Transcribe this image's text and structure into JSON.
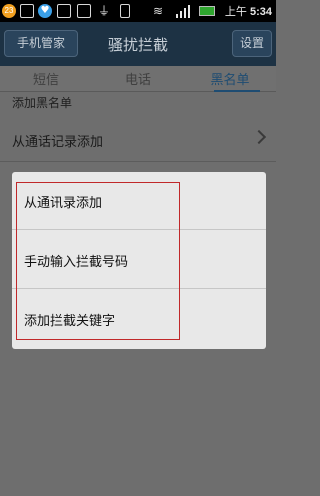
{
  "statusbar": {
    "badge": "23",
    "time_prefix": "上午",
    "time": "5:34"
  },
  "titlebar": {
    "back_label": "手机管家",
    "title": "骚扰拦截",
    "settings_label": "设置"
  },
  "tabs": [
    {
      "label": "短信"
    },
    {
      "label": "电话"
    },
    {
      "label": "黑名单",
      "active": true
    }
  ],
  "content": {
    "section_header": "添加黑名单",
    "row_label": "从通话记录添加"
  },
  "dialog": {
    "items": [
      {
        "label": "从通讯录添加"
      },
      {
        "label": "手动输入拦截号码"
      },
      {
        "label": "添加拦截关键字"
      }
    ]
  },
  "icons": [
    "qq-badge",
    "box-icon",
    "heart-icon",
    "box-icon",
    "image-icon",
    "usb-icon",
    "sdcard-icon",
    "wifi-icon",
    "signal-icon",
    "battery-icon"
  ]
}
